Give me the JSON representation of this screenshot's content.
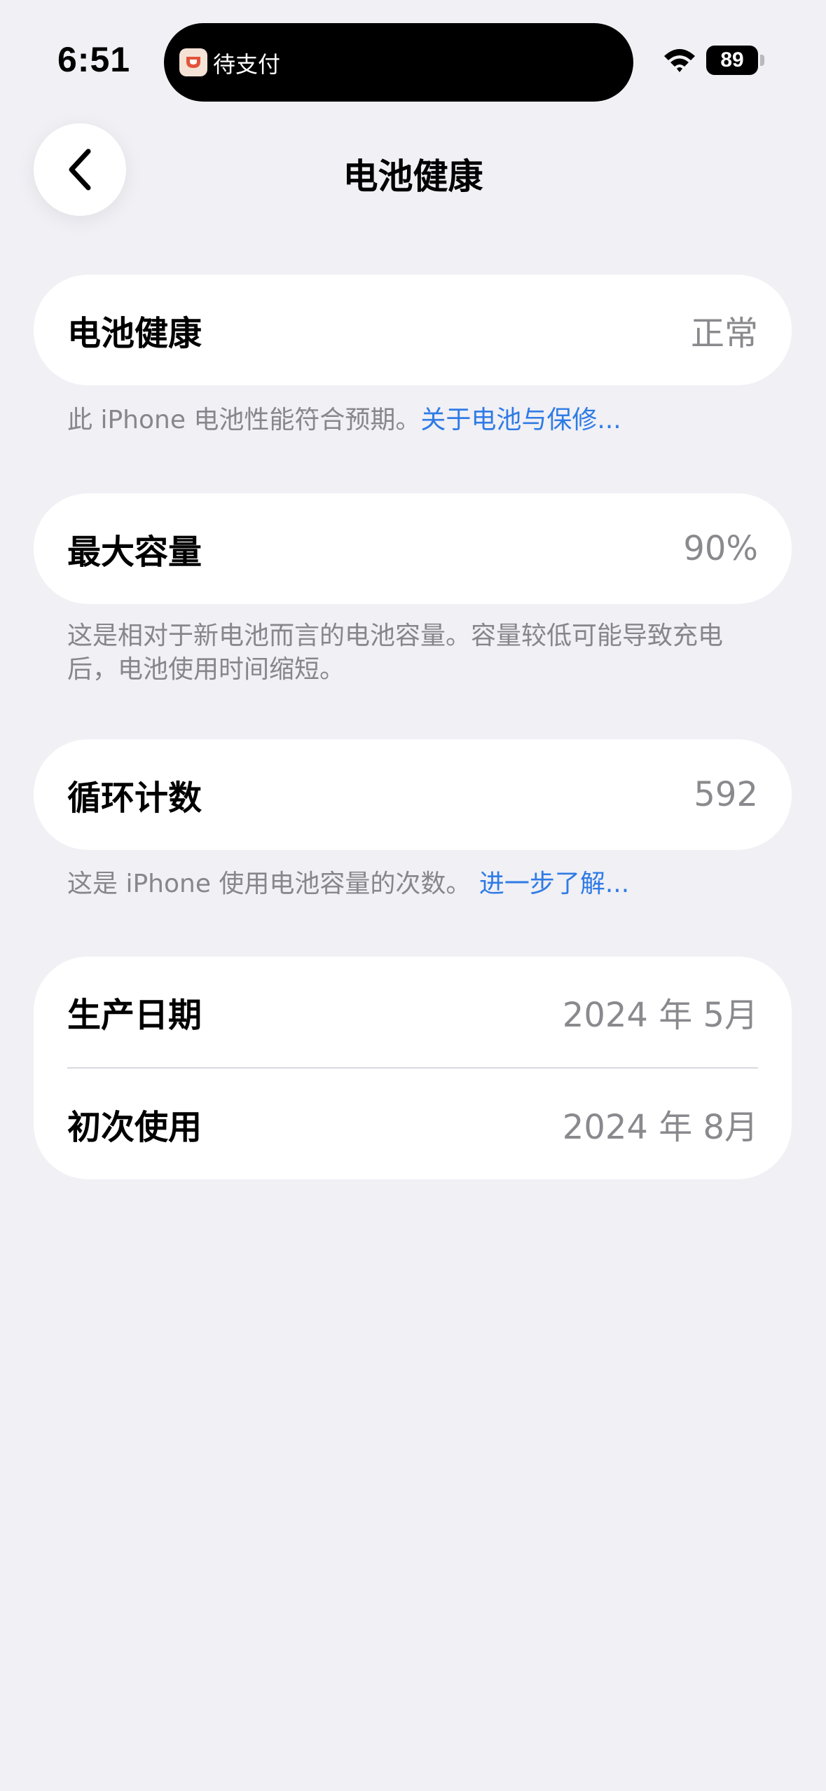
{
  "status_bar": {
    "time": "6:51",
    "island_text": "待支付",
    "battery_level": "89"
  },
  "nav": {
    "title": "电池健康"
  },
  "battery_health": {
    "label": "电池健康",
    "value": "正常",
    "footnote": "此 iPhone 电池性能符合预期。",
    "link": "关于电池与保修..."
  },
  "max_capacity": {
    "label": "最大容量",
    "value": "90%",
    "footnote": "这是相对于新电池而言的电池容量。容量较低可能导致充电后，电池使用时间缩短。"
  },
  "cycle_count": {
    "label": "循环计数",
    "value": "592",
    "footnote": "这是 iPhone 使用电池容量的次数。",
    "link": "进一步了解..."
  },
  "dates": {
    "manufacture_label": "生产日期",
    "manufacture_value": "2024 年 5月",
    "first_use_label": "初次使用",
    "first_use_value": "2024 年 8月"
  },
  "colors": {
    "background": "#f0f0f5",
    "link": "#2f7be5",
    "secondary_text": "#86868b"
  }
}
